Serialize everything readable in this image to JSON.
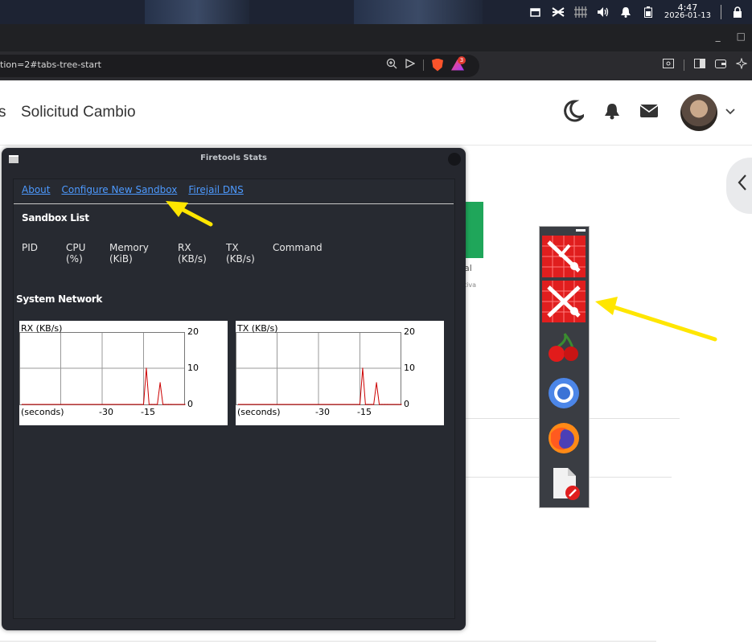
{
  "os_bar": {
    "time": "4:47",
    "date": "2026-01-13",
    "tray_icons": [
      "window-icon",
      "shuffle-icon",
      "network-icon",
      "volume-icon",
      "notification-bell-icon",
      "battery-icon",
      "lock-icon"
    ]
  },
  "browser": {
    "url_fragment": "tion=2#tabs-tree-start",
    "rewards_badge": "3",
    "window_controls": [
      "_",
      "□"
    ]
  },
  "page": {
    "title_prefix": "s",
    "title": "Solicitud Cambio",
    "fragment_1": "al",
    "fragment_2": "tiva"
  },
  "firetools": {
    "window_title": "Firetools Stats",
    "links": [
      "About",
      "Configure New Sandbox",
      "Firejail DNS"
    ],
    "sandbox_list_heading": "Sandbox List",
    "columns": [
      {
        "line1": "PID",
        "line2": ""
      },
      {
        "line1": "CPU",
        "line2": "(%)"
      },
      {
        "line1": "Memory",
        "line2": "(KiB)"
      },
      {
        "line1": "RX",
        "line2": "(KB/s)"
      },
      {
        "line1": "TX",
        "line2": "(KB/s)"
      },
      {
        "line1": "Command",
        "line2": ""
      }
    ],
    "system_network_heading": "System Network",
    "graphs": [
      {
        "caption": "RX (KB/s)",
        "y_ticks": [
          "20",
          "10",
          "0"
        ],
        "x_ticks": [
          "(seconds)",
          "-30",
          "-15"
        ]
      },
      {
        "caption": "TX (KB/s)",
        "y_ticks": [
          "20",
          "10",
          "0"
        ],
        "x_ticks": [
          "(seconds)",
          "-30",
          "-15"
        ]
      }
    ]
  },
  "chart_data": [
    {
      "type": "line",
      "title": "RX (KB/s)",
      "xlabel": "(seconds)",
      "ylabel": "",
      "x": [
        -59,
        -15,
        -14,
        -13,
        -12,
        -11,
        -10,
        -9,
        -8,
        -7,
        -6,
        -5,
        0
      ],
      "series": [
        {
          "values": [
            0,
            0,
            10,
            0,
            0,
            0,
            0,
            6,
            0,
            0,
            0,
            0,
            0
          ]
        }
      ],
      "ylim": [
        0,
        20
      ],
      "grid": true
    },
    {
      "type": "line",
      "title": "TX (KB/s)",
      "xlabel": "(seconds)",
      "ylabel": "",
      "x": [
        -59,
        -15,
        -14,
        -13,
        -12,
        -11,
        -10,
        -9,
        -8,
        -7,
        -6,
        -5,
        0
      ],
      "series": [
        {
          "values": [
            0,
            0,
            10,
            0,
            0,
            0,
            0,
            6,
            0,
            0,
            0,
            0,
            0
          ]
        }
      ],
      "ylim": [
        0,
        20
      ],
      "grid": true
    }
  ],
  "launcher": {
    "tools": [
      "firetools-config-icon",
      "firetools-tools-icon",
      "cherrytree-icon",
      "chromium-icon",
      "firefox-icon",
      "file-edit-icon"
    ]
  },
  "colors": {
    "accent_link": "#4d9aff",
    "annotation_arrow": "#ffe600",
    "tool_red": "#e01e1e",
    "graph_line": "#cc0000"
  }
}
